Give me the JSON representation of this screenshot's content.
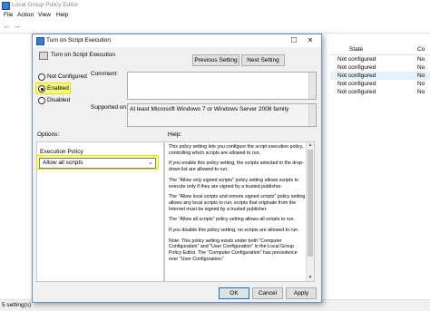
{
  "main_window": {
    "title": "Local Group Policy Editor",
    "menu": [
      "File",
      "Action",
      "View",
      "Help"
    ],
    "toolbar_icons": [
      "back-arrow-icon",
      "forward-arrow-icon"
    ],
    "list": {
      "headers": [
        "State",
        "Co"
      ],
      "rows": [
        {
          "state": "Not configured",
          "comment": "No"
        },
        {
          "state": "Not configured",
          "comment": "No"
        },
        {
          "state": "Not configured",
          "comment": "No"
        },
        {
          "state": "Not configured",
          "comment": "No"
        },
        {
          "state": "Not configured",
          "comment": "No"
        }
      ]
    },
    "status": "5 setting(s)"
  },
  "dialog": {
    "title": "Turn on Script Execution",
    "window_buttons": {
      "maximize": "☐",
      "close": "✕"
    },
    "policy_name": "Turn on Script Execution",
    "prev_button": "Previous Setting",
    "next_button": "Next Setting",
    "radios": [
      {
        "label": "Not Configured",
        "selected": false
      },
      {
        "label": "Enabled",
        "selected": true
      },
      {
        "label": "Disabled",
        "selected": false
      }
    ],
    "comment_label": "Comment:",
    "supported_label": "Supported on:",
    "supported_value": "At least Microsoft Windows 7 or Windows Server 2008 family",
    "options_label": "Options:",
    "help_label": "Help:",
    "execution_policy_label": "Execution Policy",
    "execution_policy_value": "Allow all scripts",
    "help_paragraphs": [
      "This policy setting lets you configure the script execution policy, controlling which scripts are allowed to run.",
      "If you enable this policy setting, the scripts selected in the drop-down list are allowed to run.",
      "The \"Allow only signed scripts\" policy setting allows scripts to execute only if they are signed by a trusted publisher.",
      "The \"Allow local scripts and remote signed scripts\" policy setting allows any local scripts to run; scripts that originate from the Internet must be signed by a trusted publisher.",
      "The \"Allow all scripts\" policy setting allows all scripts to run.",
      "If you disable this policy setting, no scripts are allowed to run.",
      "Note: This policy setting exists under both \"Computer Configuration\" and \"User Configuration\" in the Local Group Policy Editor. The \"Computer Configuration\" has precedence over \"User Configuration.\""
    ],
    "ok_button": "OK",
    "cancel_button": "Cancel",
    "apply_button": "Apply"
  },
  "colors": {
    "highlight": "#ffff00",
    "dialog_border": "#6a90c8",
    "ok_border": "#0078d7"
  }
}
